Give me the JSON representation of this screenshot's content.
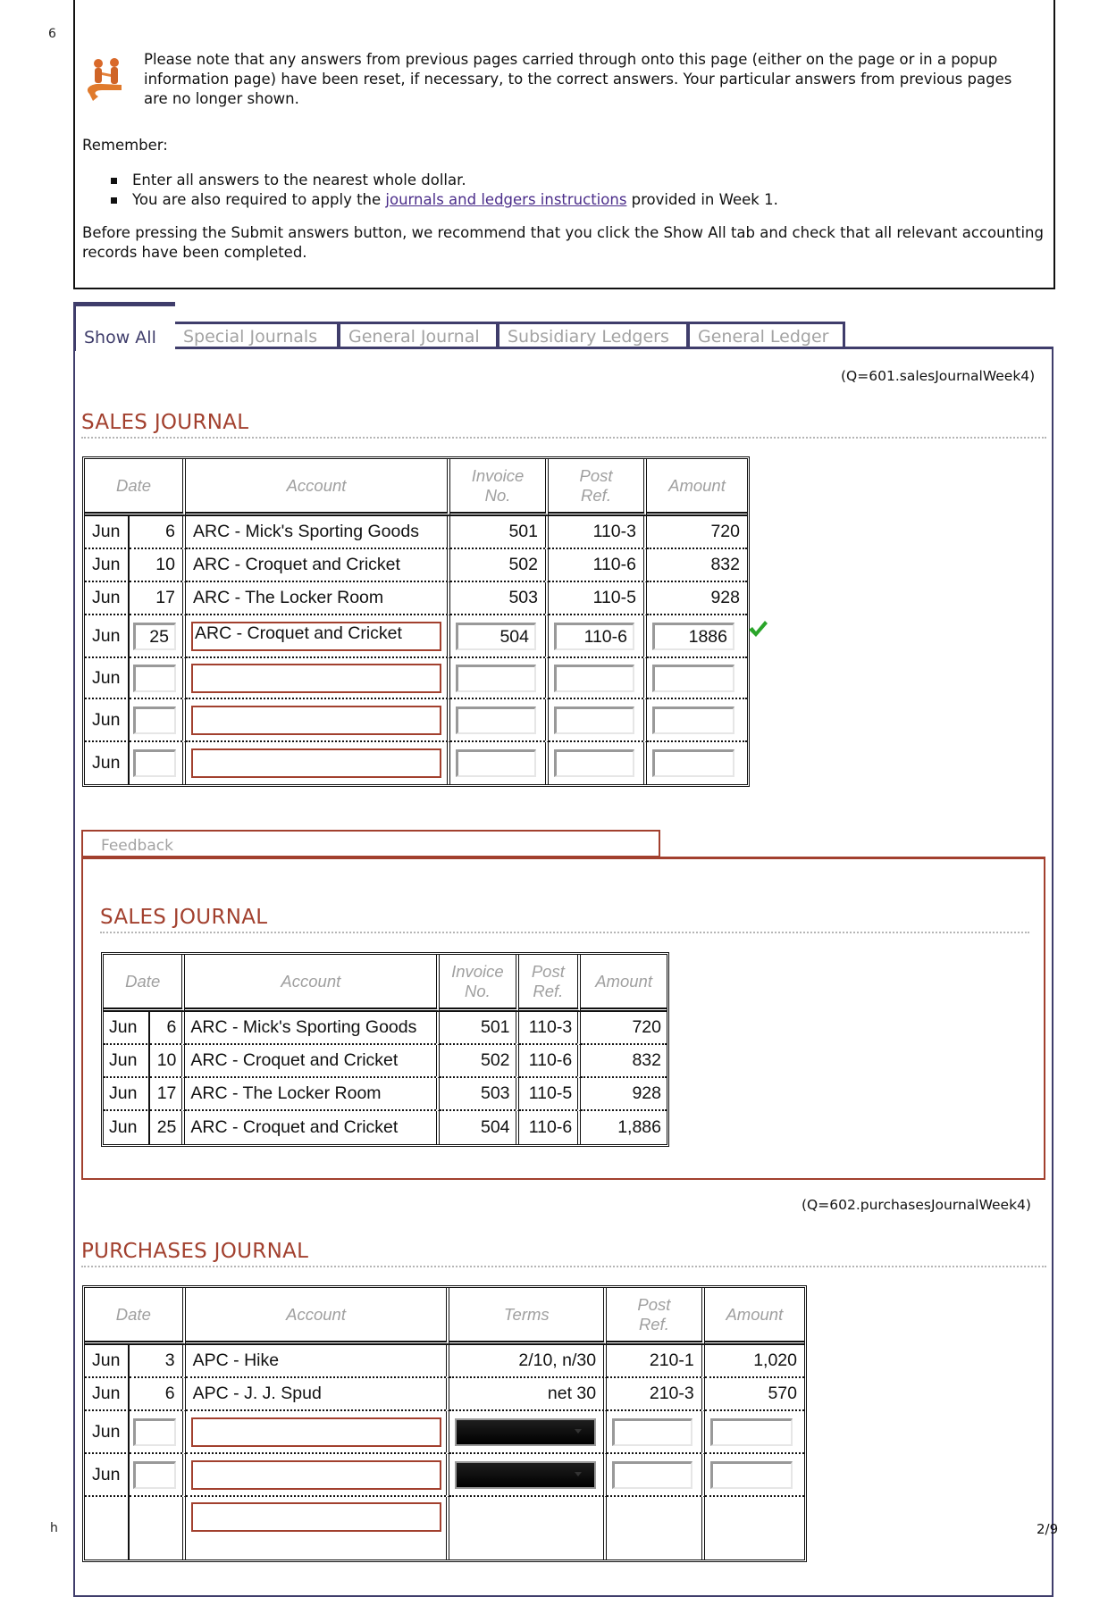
{
  "margin": {
    "left_top_char": "6",
    "left_bottom_char": "h",
    "page_number": "2/9"
  },
  "notice": {
    "icon": "people-handshake-icon",
    "text": "Please note that any answers from previous pages carried through onto this page (either on the page or in a popup information page) have been reset, if necessary, to the correct answers. Your particular answers from previous pages are no longer shown.",
    "remember_label": "Remember:",
    "bullets": {
      "b1": "Enter all answers to the nearest whole dollar.",
      "b2_pre": "You are also required to apply the ",
      "b2_link": "journals and ledgers instructions",
      "b2_post": " provided in Week 1."
    },
    "before_text": "Before pressing the Submit answers button, we recommend that you click the Show All tab and check that all relevant accounting records have been completed."
  },
  "tabs": [
    "Show All",
    "Special Journals",
    "General Journal",
    "Subsidiary Ledgers",
    "General Ledger"
  ],
  "active_tab": "Show All",
  "sales": {
    "qid": "(Q=601.salesJournalWeek4)",
    "title": "SALES JOURNAL",
    "headers": {
      "date": "Date",
      "account": "Account",
      "invoice": "Invoice No.",
      "invoice_l1": "Invoice",
      "invoice_l2": "No.",
      "post_l1": "Post",
      "post_l2": "Ref.",
      "amount": "Amount"
    },
    "rows": [
      {
        "month": "Jun",
        "day": "6",
        "account": "ARC - Mick's Sporting Goods",
        "invoice": "501",
        "post_ref": "110-3",
        "amount": "720"
      },
      {
        "month": "Jun",
        "day": "10",
        "account": "ARC - Croquet and Cricket",
        "invoice": "502",
        "post_ref": "110-6",
        "amount": "832"
      },
      {
        "month": "Jun",
        "day": "17",
        "account": "ARC - The Locker Room",
        "invoice": "503",
        "post_ref": "110-5",
        "amount": "928"
      }
    ],
    "input_rows": [
      {
        "month": "Jun",
        "day": "25",
        "account": "ARC - Croquet and Cricket",
        "invoice": "504",
        "post_ref": "110-6",
        "amount": "1886",
        "status": "correct"
      },
      {
        "month": "Jun",
        "day": "",
        "account": "",
        "invoice": "",
        "post_ref": "",
        "amount": ""
      },
      {
        "month": "Jun",
        "day": "",
        "account": "",
        "invoice": "",
        "post_ref": "",
        "amount": ""
      },
      {
        "month": "Jun",
        "day": "",
        "account": "",
        "invoice": "",
        "post_ref": "",
        "amount": ""
      }
    ]
  },
  "feedback": {
    "tab_label": "Feedback",
    "title": "SALES JOURNAL",
    "rows": [
      {
        "month": "Jun",
        "day": "6",
        "account": "ARC - Mick's Sporting Goods",
        "invoice": "501",
        "post_ref": "110-3",
        "amount": "720"
      },
      {
        "month": "Jun",
        "day": "10",
        "account": "ARC - Croquet and Cricket",
        "invoice": "502",
        "post_ref": "110-6",
        "amount": "832"
      },
      {
        "month": "Jun",
        "day": "17",
        "account": "ARC - The Locker Room",
        "invoice": "503",
        "post_ref": "110-5",
        "amount": "928"
      },
      {
        "month": "Jun",
        "day": "25",
        "account": "ARC - Croquet and Cricket",
        "invoice": "504",
        "post_ref": "110-6",
        "amount": "1,886"
      }
    ]
  },
  "purchases": {
    "qid": "(Q=602.purchasesJournalWeek4)",
    "title": "PURCHASES JOURNAL",
    "headers": {
      "date": "Date",
      "account": "Account",
      "terms": "Terms",
      "post_l1": "Post",
      "post_l2": "Ref.",
      "amount": "Amount"
    },
    "rows": [
      {
        "month": "Jun",
        "day": "3",
        "account": "APC - Hike",
        "terms": "2/10, n/30",
        "post_ref": "210-1",
        "amount": "1,020"
      },
      {
        "month": "Jun",
        "day": "6",
        "account": "APC - J. J. Spud",
        "terms": "net 30",
        "post_ref": "210-3",
        "amount": "570"
      }
    ],
    "input_rows": [
      {
        "month": "Jun",
        "day": "",
        "account": "",
        "terms": "",
        "post_ref": "",
        "amount": ""
      },
      {
        "month": "Jun",
        "day": "",
        "account": "",
        "terms": "",
        "post_ref": "",
        "amount": ""
      },
      {
        "month": "",
        "day": "",
        "account": "",
        "terms": "",
        "post_ref": "",
        "amount": ""
      }
    ]
  },
  "colors": {
    "accent_red": "#a2402e",
    "tab_border": "#3f3d6b",
    "link": "#4b2d8a",
    "check_green": "#2aa52a"
  }
}
